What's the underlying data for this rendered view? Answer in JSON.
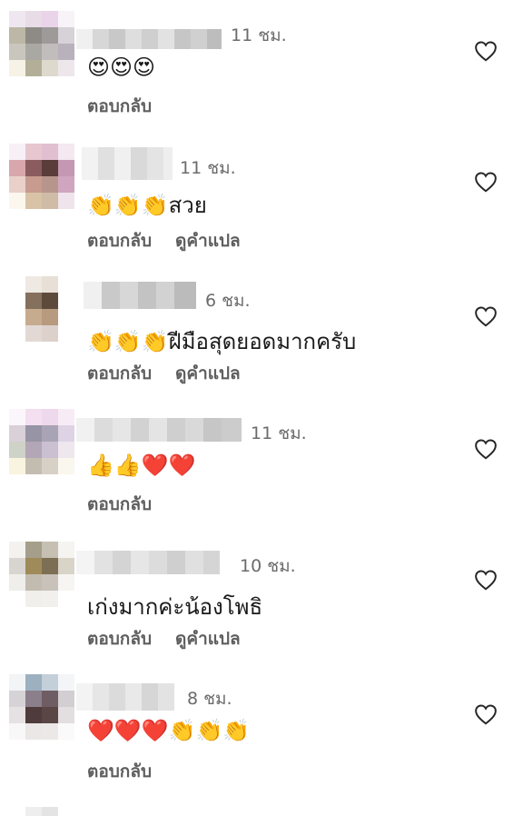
{
  "comments": [
    {
      "time": "11 ชม.",
      "text": "😍😍😍",
      "actions": [
        "ตอบกลับ"
      ]
    },
    {
      "time": "11 ชม.",
      "text": "👏👏👏สวย",
      "actions": [
        "ตอบกลับ",
        "ดูคำแปล"
      ]
    },
    {
      "time": "6 ชม.",
      "text": "👏👏👏ฝีมือสุดยอดมากครับ",
      "actions": [
        "ตอบกลับ",
        "ดูคำแปล"
      ]
    },
    {
      "time": "11 ชม.",
      "text": "👍👍❤️❤️",
      "actions": [
        "ตอบกลับ"
      ]
    },
    {
      "time": "10 ชม.",
      "text": "เก่งมากค่ะน้องโพธิ",
      "actions": [
        "ตอบกลับ",
        "ดูคำแปล"
      ]
    },
    {
      "time": "8 ชม.",
      "text": "❤️❤️❤️👏👏👏",
      "actions": [
        "ตอบกลับ"
      ]
    }
  ],
  "colors": {
    "time": "#6b6b6b",
    "action": "#5e5e5e",
    "heart": "#262626"
  }
}
